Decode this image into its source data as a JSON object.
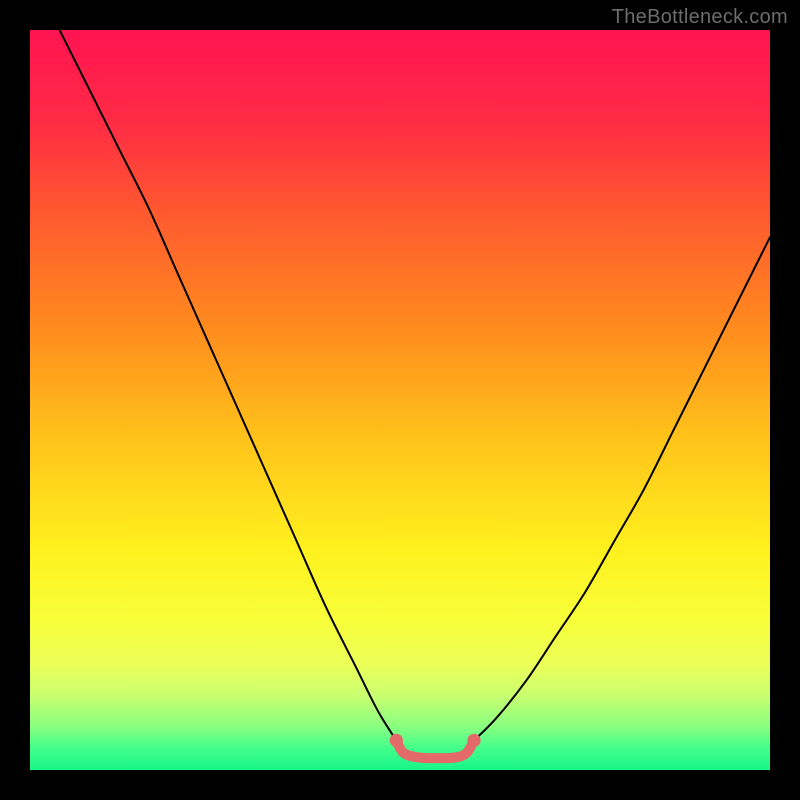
{
  "watermark": "TheBottleneck.com",
  "chart_data": {
    "type": "line",
    "title": "",
    "xlabel": "",
    "ylabel": "",
    "xlim": [
      0,
      100
    ],
    "ylim": [
      0,
      100
    ],
    "gradient_stops": [
      {
        "offset": 0,
        "color": "#ff1452"
      },
      {
        "offset": 12,
        "color": "#ff2a45"
      },
      {
        "offset": 25,
        "color": "#ff5a2f"
      },
      {
        "offset": 40,
        "color": "#ff8a1e"
      },
      {
        "offset": 55,
        "color": "#ffc21a"
      },
      {
        "offset": 70,
        "color": "#fff01e"
      },
      {
        "offset": 80,
        "color": "#f7ff3a"
      },
      {
        "offset": 86,
        "color": "#eaff5a"
      },
      {
        "offset": 90,
        "color": "#c8ff70"
      },
      {
        "offset": 94,
        "color": "#8cff80"
      },
      {
        "offset": 97,
        "color": "#44ff8a"
      },
      {
        "offset": 100,
        "color": "#18f58a"
      }
    ],
    "series": [
      {
        "name": "left-curve",
        "color": "#000000",
        "x": [
          4,
          8,
          12,
          16,
          20,
          24,
          28,
          32,
          36,
          40,
          44,
          47,
          49.5
        ],
        "y": [
          100,
          92,
          84,
          76,
          67,
          58,
          49,
          40,
          31,
          22,
          14,
          8,
          4
        ]
      },
      {
        "name": "right-curve",
        "color": "#000000",
        "x": [
          60,
          63,
          67,
          71,
          75,
          79,
          83,
          87,
          91,
          95,
          100
        ],
        "y": [
          4,
          7,
          12,
          18,
          24,
          31,
          38,
          46,
          54,
          62,
          72
        ]
      },
      {
        "name": "floor-marker",
        "color": "#e46a6a",
        "x": [
          49.5,
          50.5,
          52.5,
          55,
          57.5,
          59,
          60
        ],
        "y": [
          4,
          2.3,
          1.7,
          1.6,
          1.7,
          2.3,
          4
        ]
      }
    ],
    "marker_end_radius_pct": 0.9,
    "floor_stroke_width_px": 10,
    "curve_stroke_width_px": 2
  }
}
